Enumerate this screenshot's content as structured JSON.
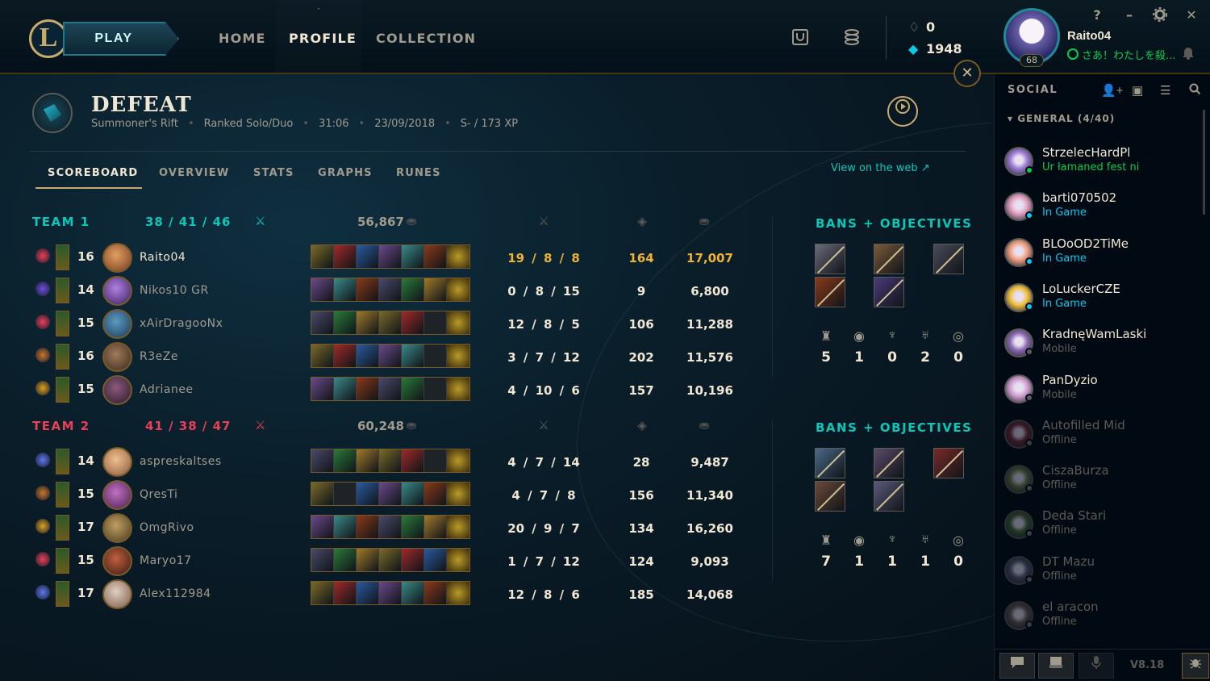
{
  "nav": {
    "play_label": "PLAY",
    "logo_text": "L",
    "tabs": [
      {
        "label": "HOME"
      },
      {
        "label": "PROFILE"
      },
      {
        "label": "COLLECTION"
      }
    ],
    "active_tab": "PROFILE"
  },
  "currency": {
    "rp": "0",
    "blue_essence": "1948"
  },
  "user": {
    "name": "Raito04",
    "level": "68",
    "status": "さあ！わたしを殺..."
  },
  "window": {
    "help": "?",
    "minimize": "–",
    "settings_icon": "gear-icon",
    "close": "✕"
  },
  "match": {
    "result": "DEFEAT",
    "map": "Summoner's Rift",
    "queue": "Ranked Solo/Duo",
    "duration": "31:06",
    "date": "23/09/2018",
    "grade_xp": "S- / 173 XP"
  },
  "subtabs": [
    {
      "label": "SCOREBOARD"
    },
    {
      "label": "OVERVIEW"
    },
    {
      "label": "STATS"
    },
    {
      "label": "GRAPHS"
    },
    {
      "label": "RUNES"
    }
  ],
  "active_subtab": "SCOREBOARD",
  "view_on_web": "View on the web",
  "teams": [
    {
      "name": "TEAM 1",
      "kda": "38  /  41  /  46",
      "gold": "56,867",
      "color": "#0ac8b9",
      "bans_title": "BANS + OBJECTIVES",
      "objectives": {
        "towers": "5",
        "inhibitors": "1",
        "barons": "0",
        "dragons": "2",
        "heralds": "0"
      },
      "players": [
        {
          "level": "16",
          "name": "Raito04",
          "kda": "19 / 8 / 8",
          "cs": "164",
          "gold": "17,007",
          "me": true
        },
        {
          "level": "14",
          "name": "Nikos10 GR",
          "kda": "0 / 8 / 15",
          "cs": "9",
          "gold": "6,800"
        },
        {
          "level": "15",
          "name": "xAirDragooNx",
          "kda": "12 / 8 / 5",
          "cs": "106",
          "gold": "11,288"
        },
        {
          "level": "16",
          "name": "R3eZe",
          "kda": "3 / 7 / 12",
          "cs": "202",
          "gold": "11,576"
        },
        {
          "level": "15",
          "name": "Adrianee",
          "kda": "4 / 10 / 6",
          "cs": "157",
          "gold": "10,196"
        }
      ]
    },
    {
      "name": "TEAM 2",
      "kda": "41  /  38  /  47",
      "gold": "60,248",
      "color": "#e84057",
      "bans_title": "BANS + OBJECTIVES",
      "objectives": {
        "towers": "7",
        "inhibitors": "1",
        "barons": "1",
        "dragons": "1",
        "heralds": "0"
      },
      "players": [
        {
          "level": "14",
          "name": "aspreskaltses",
          "kda": "4 / 7 / 14",
          "cs": "28",
          "gold": "9,487"
        },
        {
          "level": "15",
          "name": "QresTi",
          "kda": "4 / 7 / 8",
          "cs": "156",
          "gold": "11,340"
        },
        {
          "level": "17",
          "name": "OmgRivo",
          "kda": "20 / 9 / 7",
          "cs": "134",
          "gold": "16,260"
        },
        {
          "level": "15",
          "name": "Maryo17",
          "kda": "1 / 7 / 12",
          "cs": "124",
          "gold": "9,093"
        },
        {
          "level": "17",
          "name": "Alex112984",
          "kda": "12 / 8 / 6",
          "cs": "185",
          "gold": "14,068"
        }
      ]
    }
  ],
  "social": {
    "title": "SOCIAL",
    "group": "GENERAL (4/40)",
    "friends": [
      {
        "name": "StrzelecHardPl",
        "status": "Ur łamaned fest ni",
        "state": "online"
      },
      {
        "name": "barti070502",
        "status": "In Game",
        "state": "ingame"
      },
      {
        "name": "BLOoOD2TiMe",
        "status": "In Game",
        "state": "ingame"
      },
      {
        "name": "LoLuckerCZE",
        "status": "In Game",
        "state": "ingame"
      },
      {
        "name": "KradnęWamLaski",
        "status": "Mobile",
        "state": "mobile"
      },
      {
        "name": "PanDyzio",
        "status": "Mobile",
        "state": "mobile"
      },
      {
        "name": "Autofilled Mid",
        "status": "Offline",
        "state": "offline"
      },
      {
        "name": "CiszaBurza",
        "status": "Offline",
        "state": "offline"
      },
      {
        "name": "Deda Stari",
        "status": "Offline",
        "state": "offline"
      },
      {
        "name": "DT Mazu",
        "status": "Offline",
        "state": "offline"
      },
      {
        "name": "el aracon",
        "status": "Offline",
        "state": "offline"
      }
    ],
    "version": "V8.18"
  },
  "colors": {
    "gold": "#c8aa6e",
    "teal": "#0ac8b9",
    "red": "#e84057",
    "online": "#0acb4a",
    "ingame": "#0ac8f0",
    "highlight": "#f0b232"
  }
}
